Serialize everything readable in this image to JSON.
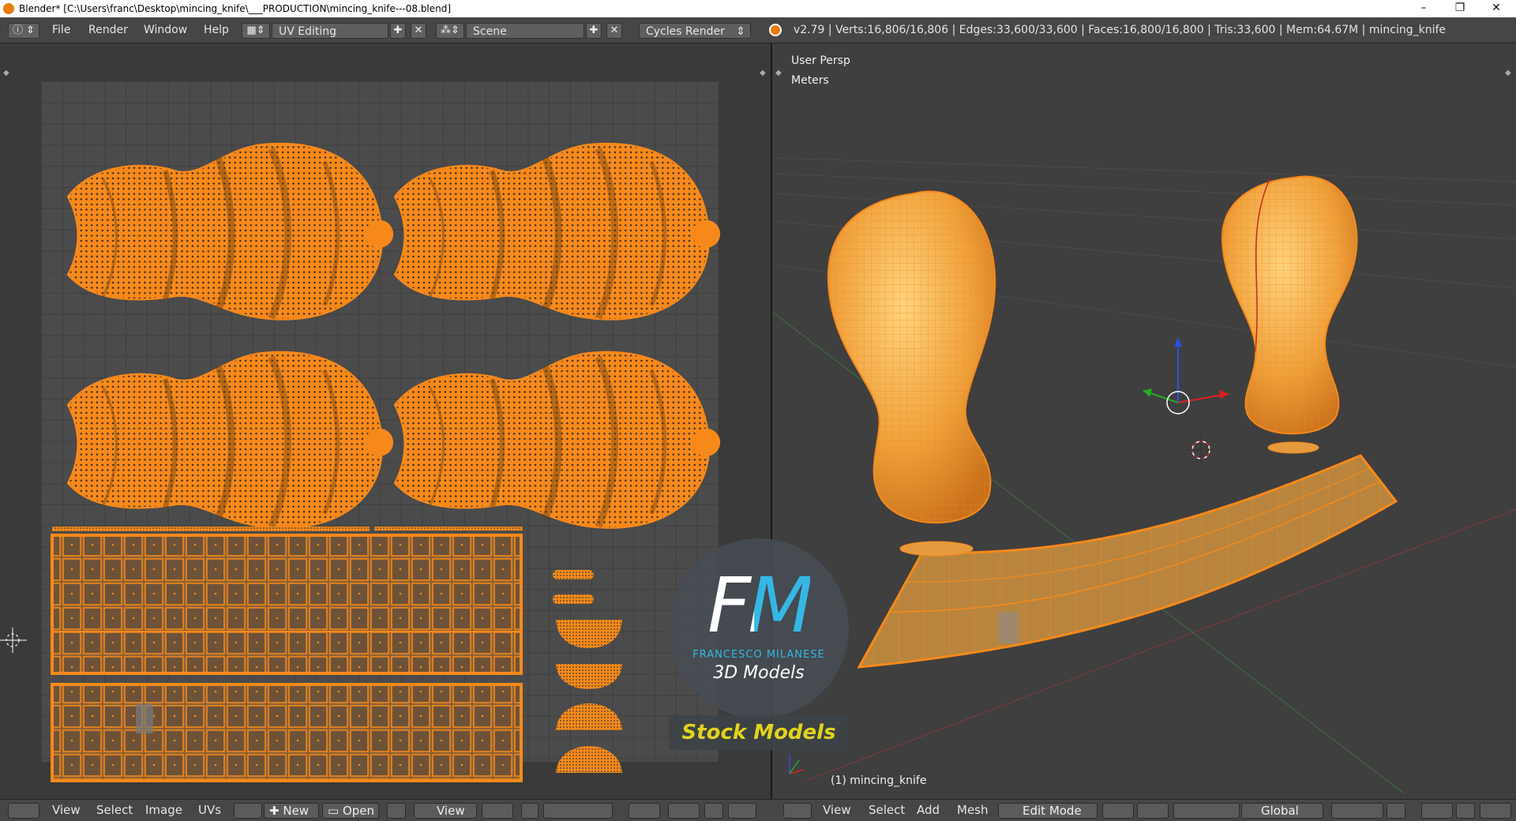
{
  "window": {
    "title": "Blender* [C:\\Users\\franc\\Desktop\\mincing_knife\\___PRODUCTION\\mincing_knife---08.blend]",
    "controls": [
      "–",
      "❐",
      "✕"
    ]
  },
  "topbar": {
    "menu": [
      "File",
      "Render",
      "Window",
      "Help"
    ],
    "layout": "UV Editing",
    "scene": "Scene",
    "engine": "Cycles Render",
    "stats": "v2.79 | Verts:16,806/16,806 | Edges:33,600/33,600 | Faces:16,800/16,800 | Tris:33,600 | Mem:64.67M | mincing_knife"
  },
  "uv_editor": {
    "menu": [
      "View",
      "Select",
      "Image",
      "UVs"
    ],
    "new_label": "New",
    "open_label": "Open",
    "view_label": "View"
  },
  "viewport": {
    "view_name": "User Persp",
    "units": "Meters",
    "object_label": "(1) mincing_knife",
    "menu": [
      "View",
      "Select",
      "Add",
      "Mesh"
    ],
    "mode": "Edit Mode",
    "orientation": "Global"
  },
  "watermark": {
    "logo_text": "FM",
    "author": "FRANCESCO MILANESE",
    "subtitle": "3D Models",
    "banner": "Stock Models"
  },
  "colors": {
    "accent_orange": "#f7891a",
    "blender_bg": "#464646",
    "watermark_teal": "#35b7e6",
    "banner_yellow": "#e1d31c"
  }
}
